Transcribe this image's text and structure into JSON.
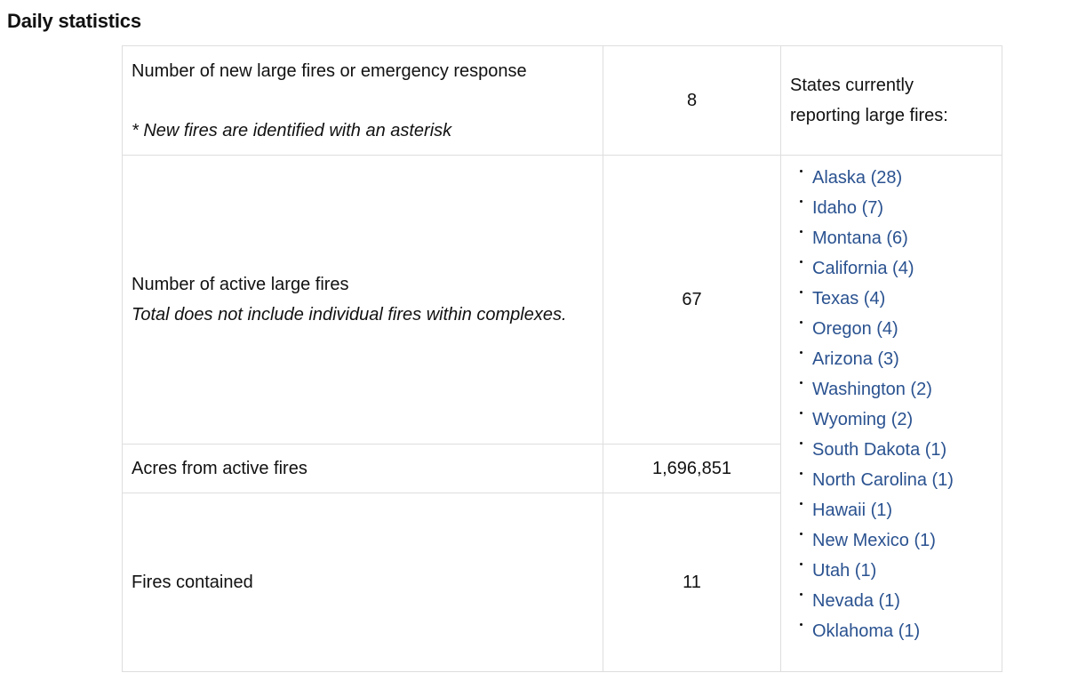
{
  "page": {
    "heading": "Daily statistics"
  },
  "table": {
    "row1": {
      "label": "Number of new large fires or emergency response",
      "note": "* New fires are identified with an asterisk",
      "value": "8"
    },
    "row2": {
      "label": "Number of active large fires",
      "note": "Total does not include individual fires within complexes.",
      "value": "67"
    },
    "row3": {
      "label": "Acres from active fires",
      "value": "1,696,851"
    },
    "row4": {
      "label": "Fires contained",
      "value": "11"
    },
    "states_header": "States currently reporting large fires:",
    "states": [
      "Alaska (28)",
      "Idaho (7)",
      "Montana (6)",
      "California (4)",
      "Texas (4)",
      "Oregon (4)",
      "Arizona (3)",
      "Washington (2)",
      "Wyoming (2)",
      "South Dakota (1)",
      "North Carolina (1)",
      "Hawaii (1)",
      "New Mexico (1)",
      "Utah (1)",
      "Nevada (1)",
      "Oklahoma (1)"
    ]
  },
  "colors": {
    "link": "#2a5290",
    "border": "#dedede",
    "text": "#111111"
  }
}
